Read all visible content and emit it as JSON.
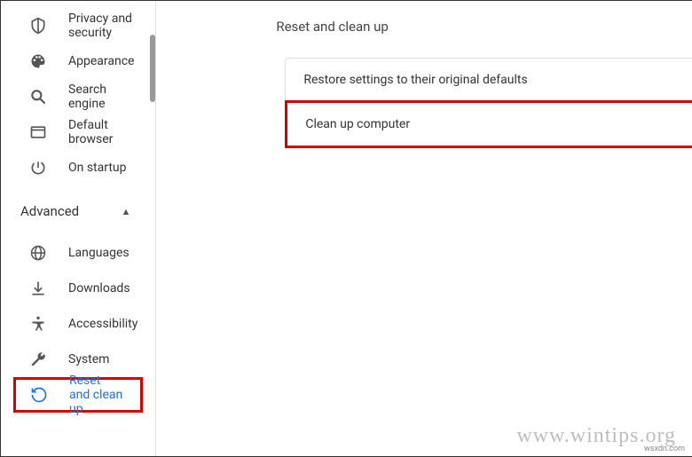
{
  "sidebar": {
    "items": [
      {
        "label": "Privacy and security",
        "icon": "shield-icon"
      },
      {
        "label": "Appearance",
        "icon": "palette-icon"
      },
      {
        "label": "Search engine",
        "icon": "search-icon"
      },
      {
        "label": "Default browser",
        "icon": "browser-icon"
      },
      {
        "label": "On startup",
        "icon": "power-icon"
      }
    ],
    "advanced_header": "Advanced",
    "advanced_items": [
      {
        "label": "Languages",
        "icon": "globe-icon"
      },
      {
        "label": "Downloads",
        "icon": "download-icon"
      },
      {
        "label": "Accessibility",
        "icon": "accessibility-icon"
      },
      {
        "label": "System",
        "icon": "wrench-icon"
      },
      {
        "label": "Reset and clean up",
        "icon": "reset-icon",
        "active": true,
        "highlight": true
      }
    ]
  },
  "main": {
    "title": "Reset and clean up",
    "card_items": [
      {
        "label": "Restore settings to their original defaults"
      },
      {
        "label": "Clean up computer",
        "highlight": true
      }
    ]
  },
  "watermark": "www.wintips.org",
  "credit": "wsxdn.com"
}
